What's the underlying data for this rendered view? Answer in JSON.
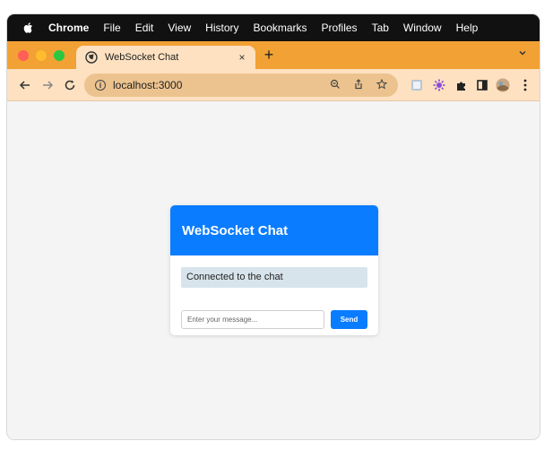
{
  "menubar": {
    "app": "Chrome",
    "items": [
      "File",
      "Edit",
      "View",
      "History",
      "Bookmarks",
      "Profiles",
      "Tab",
      "Window",
      "Help"
    ]
  },
  "tab": {
    "title": "WebSocket Chat",
    "close": "×",
    "new_tab": "+"
  },
  "toolbar": {
    "url": "localhost:3000"
  },
  "chat": {
    "title": "WebSocket Chat",
    "status": "Connected to the chat",
    "input_placeholder": "Enter your message...",
    "send_label": "Send"
  },
  "colors": {
    "accent": "#0a7cff",
    "tab_strip": "#f2a134",
    "toolbar": "#fde1c0",
    "status_bg": "#d8e4ec"
  }
}
